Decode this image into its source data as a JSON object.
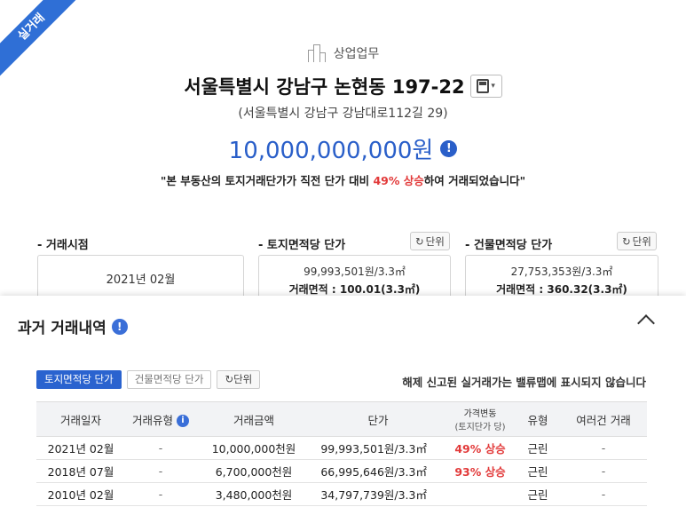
{
  "ribbon": "실거래",
  "category": "상업업무",
  "address": "서울특별시 강남구 논현동 197-22",
  "road_address": "(서울특별시 강남구 강남대로112길 29)",
  "price": "10,000,000,000원",
  "notice": {
    "prefix": "\"본 부동산의 토지거래단가가 직전 단가 대비 ",
    "highlight": "49% 상승",
    "suffix": "하여 거래되었습니다\""
  },
  "sections": {
    "trade_time_label": "- 거래시점",
    "land_unit_label": "- 토지면적당 단가",
    "building_unit_label": "- 건물면적당 단가",
    "unit_button": "단위",
    "trade_time_value": "2021년 02월",
    "land_price": "99,993,501원/3.3㎡",
    "land_area": "거래면적 : 100.01(3.3㎡)",
    "building_price": "27,753,353원/3.3㎡",
    "building_area": "거래면적 : 360.32(3.3㎡)"
  },
  "history": {
    "title": "과거 거래내역",
    "tabs": [
      "토지면적당 단가",
      "건물면적당 단가"
    ],
    "unit_button": "단위",
    "note": "해제 신고된 실거래가는 밸류맵에 표시되지 않습니다",
    "columns": [
      "거래일자",
      "거래유형",
      "거래금액",
      "단가",
      "가격변동",
      "(토지단가 당)",
      "유형",
      "여러건 거래"
    ],
    "rows": [
      {
        "date": "2021년 02월",
        "type": "-",
        "amount": "10,000,000천원",
        "unit_price": "99,993,501원/3.3㎡",
        "change": "49% 상승",
        "kind": "근린",
        "multi": "-"
      },
      {
        "date": "2018년 07월",
        "type": "-",
        "amount": "6,700,000천원",
        "unit_price": "66,995,646원/3.3㎡",
        "change": "93% 상승",
        "kind": "근린",
        "multi": "-"
      },
      {
        "date": "2010년 02월",
        "type": "-",
        "amount": "3,480,000천원",
        "unit_price": "34,797,739원/3.3㎡",
        "change": "",
        "kind": "근린",
        "multi": "-"
      }
    ]
  },
  "colors": {
    "accent": "#2a63cf",
    "increase": "#e23a3a"
  }
}
